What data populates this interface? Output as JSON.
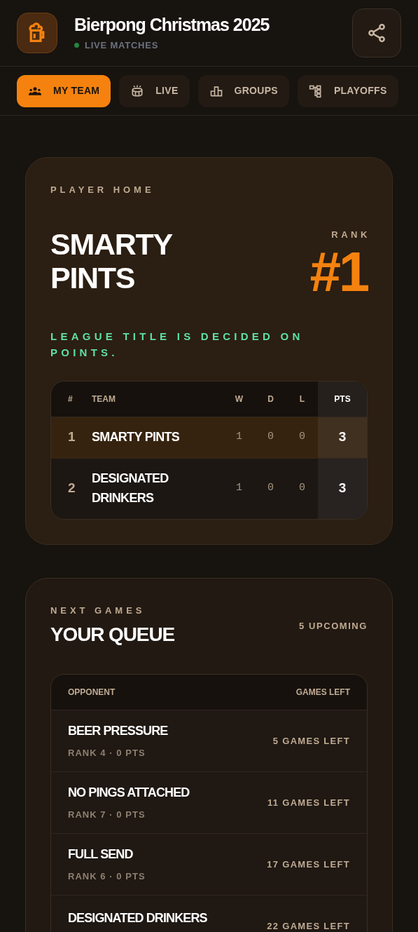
{
  "header": {
    "title": "Bierpong Christmas 2025",
    "status": "LIVE MATCHES",
    "live": true
  },
  "tabs": [
    {
      "label": "MY TEAM",
      "selected": true
    },
    {
      "label": "LIVE",
      "selected": false
    },
    {
      "label": "GROUPS",
      "selected": false
    },
    {
      "label": "PLAYOFFS",
      "selected": false
    }
  ],
  "player_card": {
    "eyebrow": "PLAYER HOME",
    "team": "SMARTY PINTS",
    "rank_label": "RANK",
    "rank": "#1",
    "note": "LEAGUE TITLE IS DECIDED ON POINTS.",
    "table": {
      "columns": [
        "#",
        "TEAM",
        "W",
        "D",
        "L",
        "PTS"
      ],
      "rows": [
        {
          "cells": [
            "1",
            "SMARTY PINTS",
            "1",
            "0",
            "0",
            "3"
          ],
          "selected": true
        },
        {
          "cells": [
            "2",
            "DESIGNATED DRINKERS",
            "1",
            "0",
            "0",
            "3"
          ],
          "selected": false
        }
      ]
    }
  },
  "queue_card": {
    "eyebrow": "NEXT GAMES",
    "title": "YOUR QUEUE",
    "count": "5 UPCOMING",
    "columns": [
      "OPPONENT",
      "GAMES LEFT"
    ],
    "rows": [
      {
        "opponent": "BEER PRESSURE",
        "meta": "RANK 4 · 0 PTS",
        "games_left": "5 GAMES LEFT"
      },
      {
        "opponent": "NO PINGS ATTACHED",
        "meta": "RANK 7 · 0 PTS",
        "games_left": "11 GAMES LEFT"
      },
      {
        "opponent": "FULL SEND",
        "meta": "RANK 6 · 0 PTS",
        "games_left": "17 GAMES LEFT"
      },
      {
        "opponent": "DESIGNATED DRINKERS",
        "games_left": "22 GAMES LEFT"
      }
    ]
  }
}
